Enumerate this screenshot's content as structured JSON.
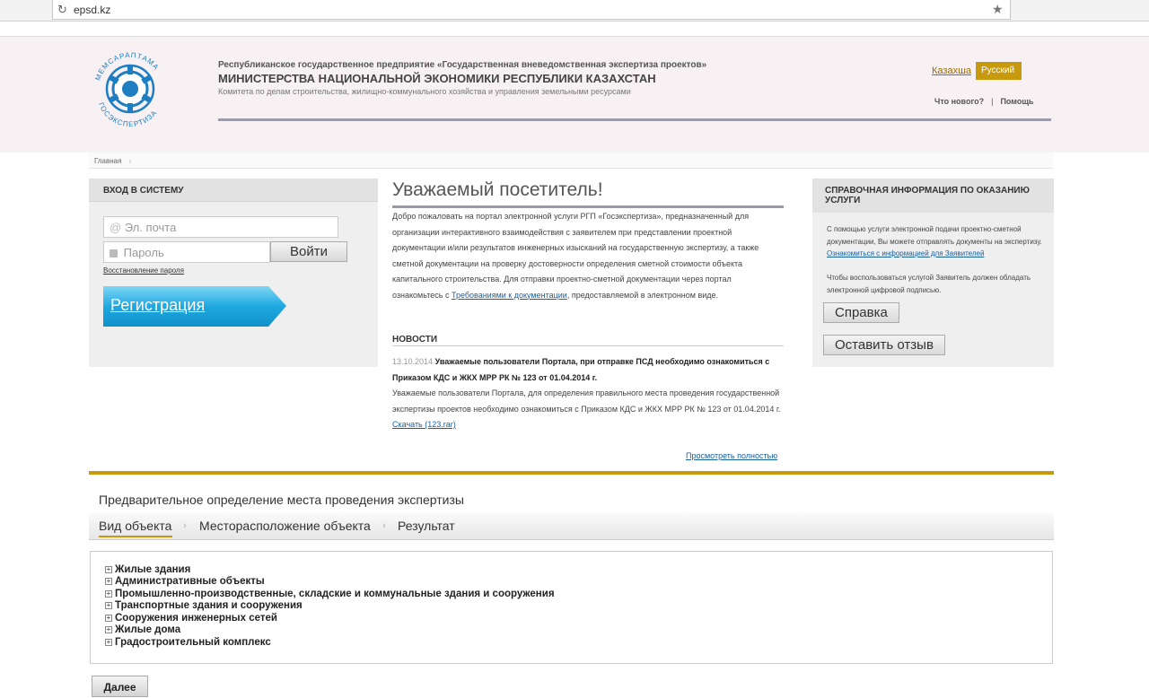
{
  "browser": {
    "url": "epsd.kz"
  },
  "header": {
    "org_line1": "Республиканское государственное предприятие «Государственная вневедомственная экспертиза проектов»",
    "org_line2": "МИНИСТЕРСТВА НАЦИОНАЛЬНОЙ ЭКОНОМИКИ РЕСПУБЛИКИ КАЗАХСТАН",
    "org_line3": "Комитета по делам строительства, жилищно-коммунального хозяйства и управления земельными ресурсами",
    "logo_text_top": "МЕМСАРАПТАМА",
    "logo_text_bottom": "ГОСЭКСПЕРТИЗА",
    "lang_kz": "Казахша",
    "lang_ru": "Русский",
    "whats_new": "Что нового?",
    "separator": "|",
    "help": "Помощь"
  },
  "breadcrumb": {
    "home": "Главная",
    "arrow": "›"
  },
  "login": {
    "title": "ВХОД В СИСТЕМУ",
    "email_placeholder": "Эл. почта",
    "password_placeholder": "Пароль",
    "login_button": "Войти",
    "recover_link": "Восстановление пароля",
    "register": "Регистрация"
  },
  "welcome": {
    "title": "Уважаемый посетитель!",
    "text_before_link": "Добро пожаловать на портал электронной услуги РГП «Госэкспертиза», предназначенный для организации интерактивного взаимодействия с заявителем при представлении проектной документации и/или результатов инженерных изысканий на государственную экспертизу, а также сметной документации на проверку достоверности определения сметной стоимости объекта капитального строительства. Для отправки проектно-сметной документации через портал ознакомьтесь с ",
    "link": "Требованиями к документации",
    "text_after_link": ", предоставляемой в электронном виде."
  },
  "news": {
    "title": "НОВОСТИ",
    "date": "13.10.2014",
    "headline": "Уважаемые пользователи Портала, при отправке ПСД необходимо ознакомиться с Приказом КДС и ЖКХ МРР РК № 123 от 01.04.2014 г.",
    "body": "Уважаемые пользователи Портала, для определения правильного места проведения государственной экспертизы проектов необходимо ознакомиться с Приказом КДС и ЖКХ МРР РК № 123 от 01.04.2014 г.",
    "download": "Скачать (123.rar)",
    "view_all": "Просмотреть полностью"
  },
  "reference": {
    "title": "СПРАВОЧНАЯ ИНФОРМАЦИЯ ПО ОКАЗАНИЮ УСЛУГИ",
    "text1": "С помощью услуги электронной подачи проектно-сметной документации, Вы можете отправлять документы на экспертизу. ",
    "text1_link": "Ознакомиться с информацией для Заявителей",
    "text2": "Чтобы воспользоваться услугой Заявитель должен обладать электронной цифровой подписью.",
    "help_button": "Справка",
    "feedback_button": "Оставить отзыв"
  },
  "expertise": {
    "title": "Предварительное определение места проведения экспертизы",
    "tabs": [
      "Вид объекта",
      "Месторасположение объекта",
      "Результат"
    ],
    "tab_arrow": "›",
    "tree_expand": "+",
    "tree": [
      "Жилые здания",
      "Административные объекты",
      "Промышленно-производственные, складские и коммунальные здания и сооружения",
      "Транспортные здания и сооружения",
      "Сооружения инженерных сетей",
      "Жилые дома",
      "Градостроительный комплекс"
    ],
    "next_button": "Далее"
  },
  "colors": {
    "accent": "#c79a0e",
    "link": "#1a5fa0",
    "register": "#1fa9e1"
  },
  "icons": [
    "reload-icon",
    "star-icon",
    "email-icon",
    "lock-icon",
    "expand-icon"
  ]
}
